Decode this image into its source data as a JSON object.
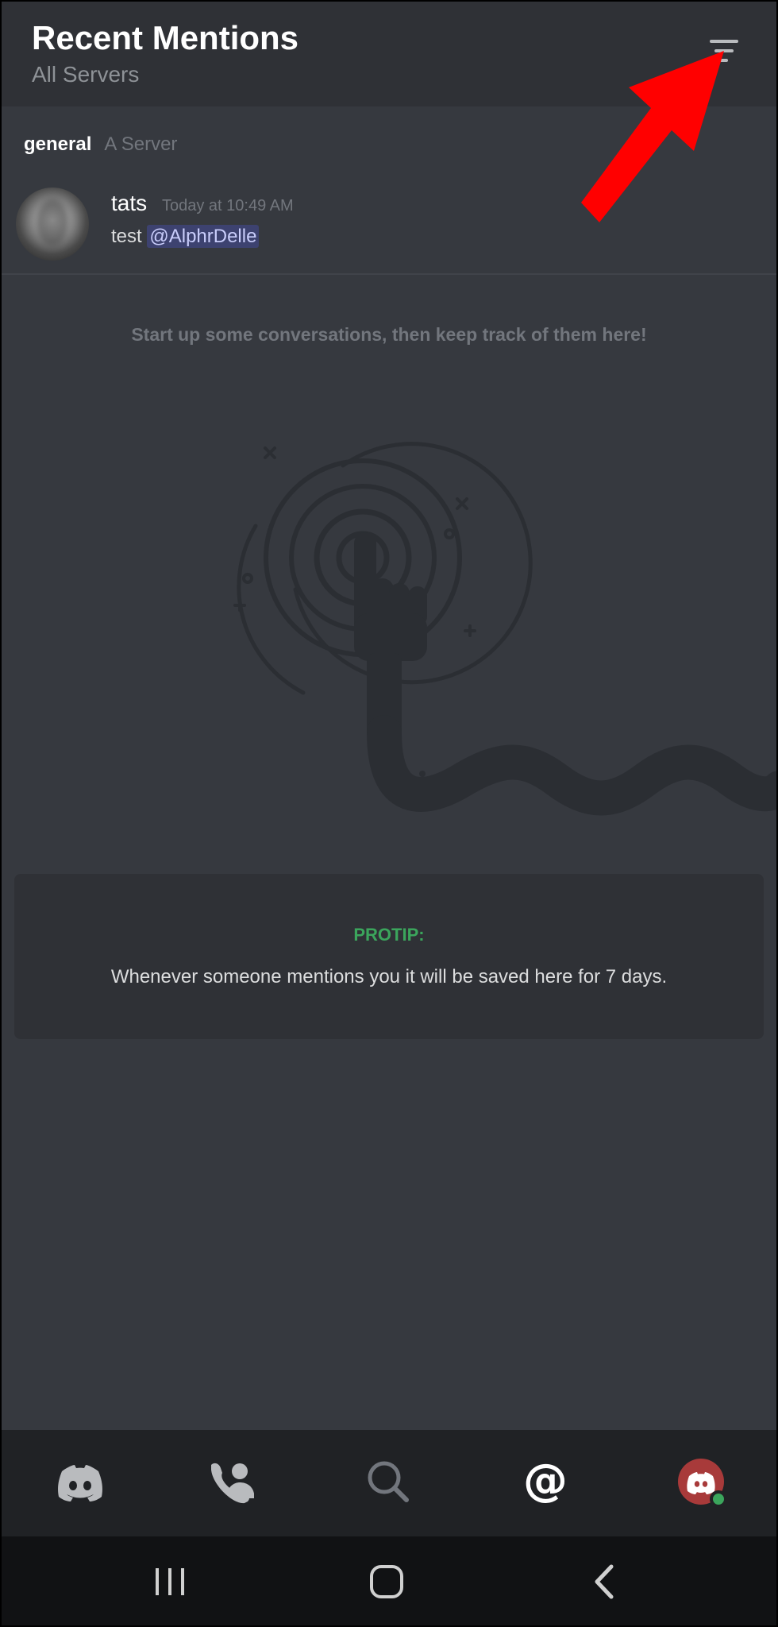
{
  "header": {
    "title": "Recent Mentions",
    "subtitle": "All Servers",
    "filter_icon": "filter-icon"
  },
  "mention": {
    "channel": "general",
    "server": "A Server",
    "author": "tats",
    "timestamp": "Today at 10:49 AM",
    "text_prefix": "test",
    "mention": "@AlphrDelle"
  },
  "empty_state": {
    "message": "Start up some conversations, then keep track of them here!"
  },
  "protip": {
    "label": "PROTIP:",
    "text": "Whenever someone mentions you it will be saved here for 7 days."
  },
  "bottom_nav": [
    {
      "icon": "discord-home-icon",
      "active": false
    },
    {
      "icon": "friends-icon",
      "active": false
    },
    {
      "icon": "search-icon",
      "active": false
    },
    {
      "icon": "mentions-icon",
      "active": true
    },
    {
      "icon": "profile-avatar-icon",
      "active": false,
      "status": "online"
    }
  ],
  "system_nav": [
    "recent-apps-icon",
    "home-icon",
    "back-icon"
  ],
  "colors": {
    "background": "#36393f",
    "header": "#2f3136",
    "protip_green": "#3ba55c",
    "mention_highlight": "#3d4270",
    "annotation_red": "#ff0000"
  }
}
